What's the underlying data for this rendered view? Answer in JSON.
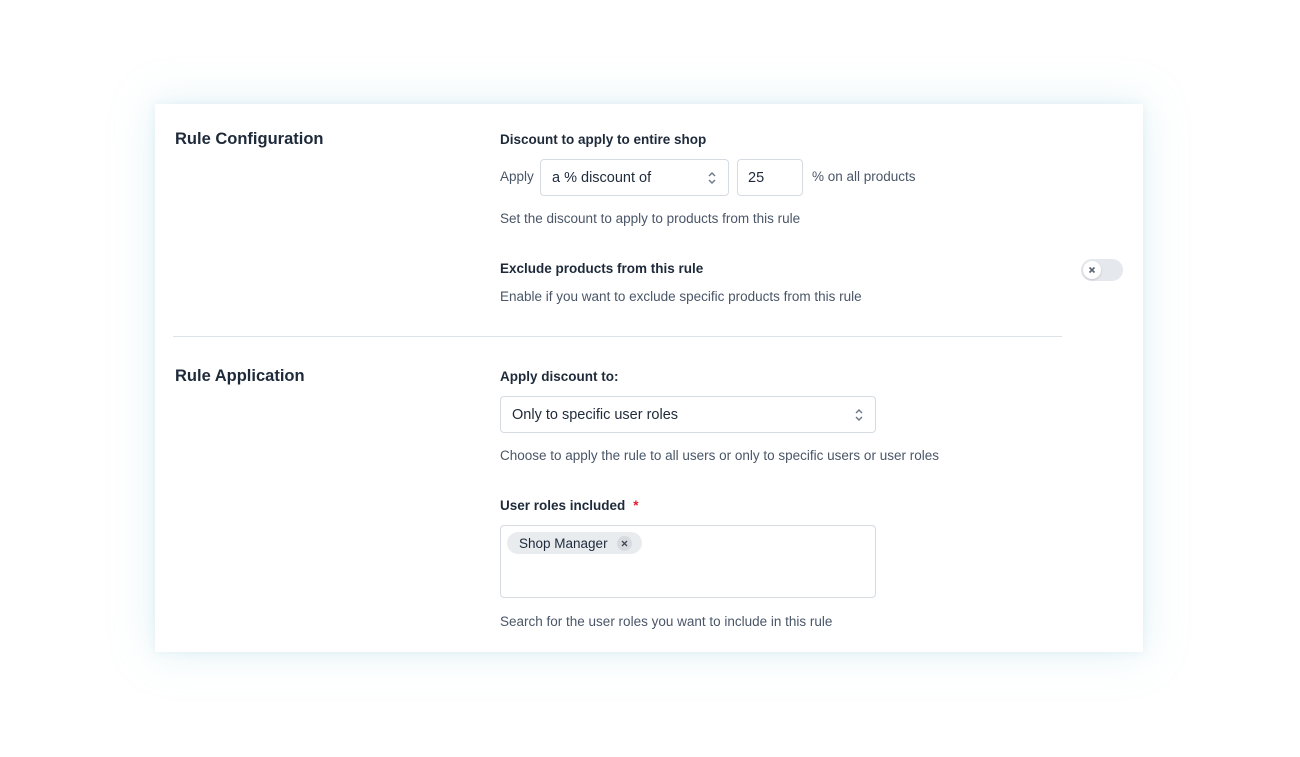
{
  "rule_configuration": {
    "title": "Rule Configuration",
    "discount_label": "Discount to apply to entire shop",
    "apply_prefix": "Apply",
    "discount_type_select": {
      "value": "a % discount of"
    },
    "discount_amount": {
      "value": "25"
    },
    "suffix": "% on all products",
    "discount_help": "Set the discount to apply to products from this rule",
    "exclude_label": "Exclude products from this rule",
    "exclude_help": "Enable if you want to exclude specific products from this rule",
    "exclude_toggle": {
      "state": "off"
    }
  },
  "rule_application": {
    "title": "Rule Application",
    "apply_to_label": "Apply discount to:",
    "apply_to_select": {
      "value": "Only to specific user roles"
    },
    "apply_to_help": "Choose to apply the rule to all users or only to specific users or user roles",
    "roles_label": "User roles included",
    "required_marker": "*",
    "roles": [
      "Shop Manager"
    ],
    "roles_help": "Search for the user roles you want to include in this rule"
  },
  "icons": {
    "select_chevron": "chevron-up-down-icon",
    "toggle_off": "close-icon",
    "tag_remove": "close-icon"
  },
  "colors": {
    "required": "#e0212b",
    "border": "#d6dbe1",
    "text": "#1e2a3a",
    "muted_text": "#4a5668"
  }
}
